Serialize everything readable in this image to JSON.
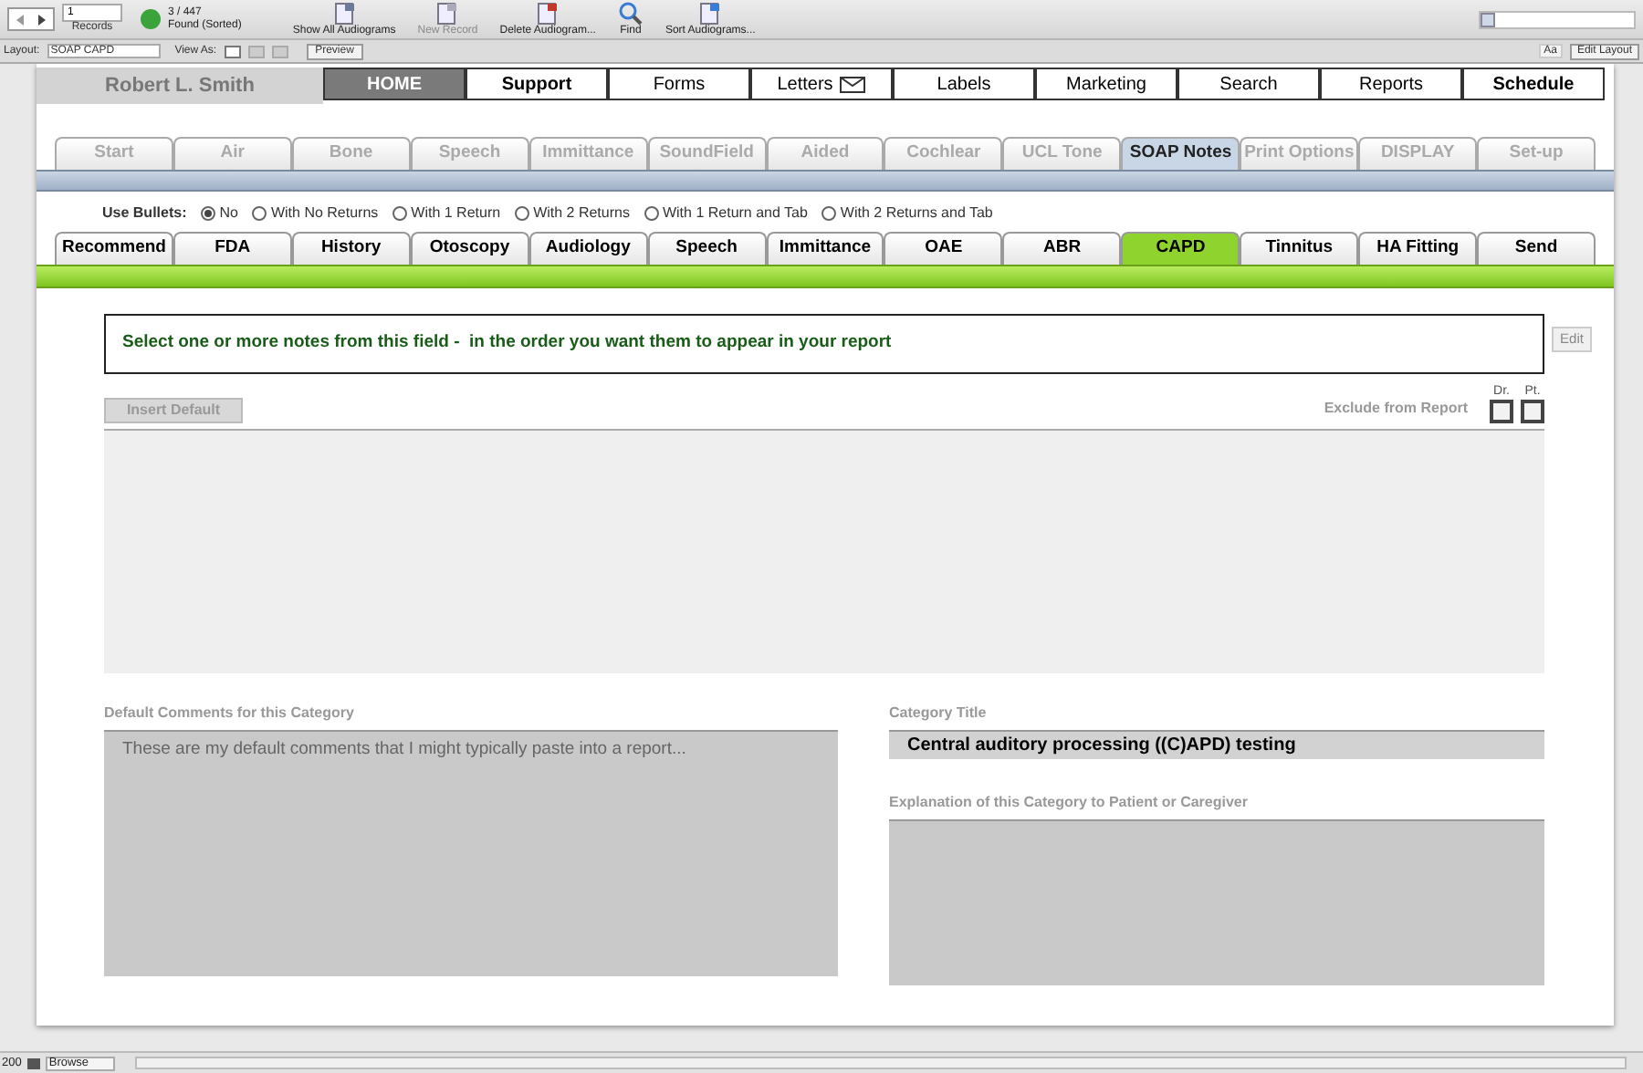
{
  "toolbar": {
    "record": "1",
    "records_label": "Records",
    "found": "3 / 447",
    "found_status": "Found (Sorted)",
    "buttons": [
      {
        "label": "Show All Audiograms",
        "disabled": false
      },
      {
        "label": "New Record",
        "disabled": true
      },
      {
        "label": "Delete Audiogram...",
        "disabled": false
      },
      {
        "label": "Find",
        "disabled": false
      },
      {
        "label": "Sort Audiograms...",
        "disabled": false
      }
    ]
  },
  "layout_bar": {
    "layout_label": "Layout:",
    "layout_value": "SOAP CAPD",
    "view_as": "View As:",
    "preview": "Preview",
    "aa": "Aa",
    "edit_layout": "Edit Layout"
  },
  "patient_name": "Robert L. Smith",
  "nav": [
    {
      "label": "HOME",
      "selected": true,
      "emphasized": true,
      "mail_icon": false
    },
    {
      "label": "Support",
      "selected": false,
      "emphasized": true,
      "mail_icon": false
    },
    {
      "label": "Forms",
      "selected": false,
      "emphasized": false,
      "mail_icon": false
    },
    {
      "label": "Letters",
      "selected": false,
      "emphasized": false,
      "mail_icon": true
    },
    {
      "label": "Labels",
      "selected": false,
      "emphasized": false,
      "mail_icon": false
    },
    {
      "label": "Marketing",
      "selected": false,
      "emphasized": false,
      "mail_icon": false
    },
    {
      "label": "Search",
      "selected": false,
      "emphasized": false,
      "mail_icon": false
    },
    {
      "label": "Reports",
      "selected": false,
      "emphasized": false,
      "mail_icon": false
    },
    {
      "label": "Schedule",
      "selected": false,
      "emphasized": true,
      "mail_icon": false
    }
  ],
  "module_tabs": [
    {
      "label": "Start",
      "selected": false
    },
    {
      "label": "Air",
      "selected": false
    },
    {
      "label": "Bone",
      "selected": false
    },
    {
      "label": "Speech",
      "selected": false
    },
    {
      "label": "Immittance",
      "selected": false
    },
    {
      "label": "SoundField",
      "selected": false
    },
    {
      "label": "Aided",
      "selected": false
    },
    {
      "label": "Cochlear",
      "selected": false
    },
    {
      "label": "UCL Tone",
      "selected": false
    },
    {
      "label": "SOAP Notes",
      "selected": true
    },
    {
      "label": "Print Options",
      "selected": false
    },
    {
      "label": "DISPLAY",
      "selected": false
    },
    {
      "label": "Set-up",
      "selected": false
    }
  ],
  "bullets": {
    "label": "Use Bullets:",
    "options": [
      {
        "label": "No",
        "selected": true
      },
      {
        "label": "With No Returns",
        "selected": false
      },
      {
        "label": "With 1 Return",
        "selected": false
      },
      {
        "label": "With 2 Returns",
        "selected": false
      },
      {
        "label": "With 1 Return and Tab",
        "selected": false
      },
      {
        "label": "With 2 Returns and Tab",
        "selected": false
      }
    ]
  },
  "category_tabs": [
    {
      "label": "Recommend",
      "selected": false
    },
    {
      "label": "FDA",
      "selected": false
    },
    {
      "label": "History",
      "selected": false
    },
    {
      "label": "Otoscopy",
      "selected": false
    },
    {
      "label": "Audiology",
      "selected": false
    },
    {
      "label": "Speech",
      "selected": false
    },
    {
      "label": "Immittance",
      "selected": false
    },
    {
      "label": "OAE",
      "selected": false
    },
    {
      "label": "ABR",
      "selected": false
    },
    {
      "label": "CAPD",
      "selected": true
    },
    {
      "label": "Tinnitus",
      "selected": false
    },
    {
      "label": "HA Fitting",
      "selected": false
    },
    {
      "label": "Send",
      "selected": false
    }
  ],
  "instruction": "Select one or more notes from this field -  in the order you want them to appear in your report",
  "edit_button": "Edit",
  "insert_default": "Insert Default",
  "exclude_label": "Exclude from Report",
  "exclude_checks": [
    {
      "label": "Dr.",
      "checked": false
    },
    {
      "label": "Pt.",
      "checked": false
    }
  ],
  "default_comments": {
    "label": "Default Comments for this Category",
    "value": "These are my default comments that I might typically paste into a report..."
  },
  "category_title": {
    "label": "Category Title",
    "value": "Central auditory processing ((C)APD) testing"
  },
  "explanation": {
    "label": "Explanation of this Category to Patient or Caregiver"
  },
  "status_bar": {
    "zoom": "200",
    "mode": "Browse"
  }
}
